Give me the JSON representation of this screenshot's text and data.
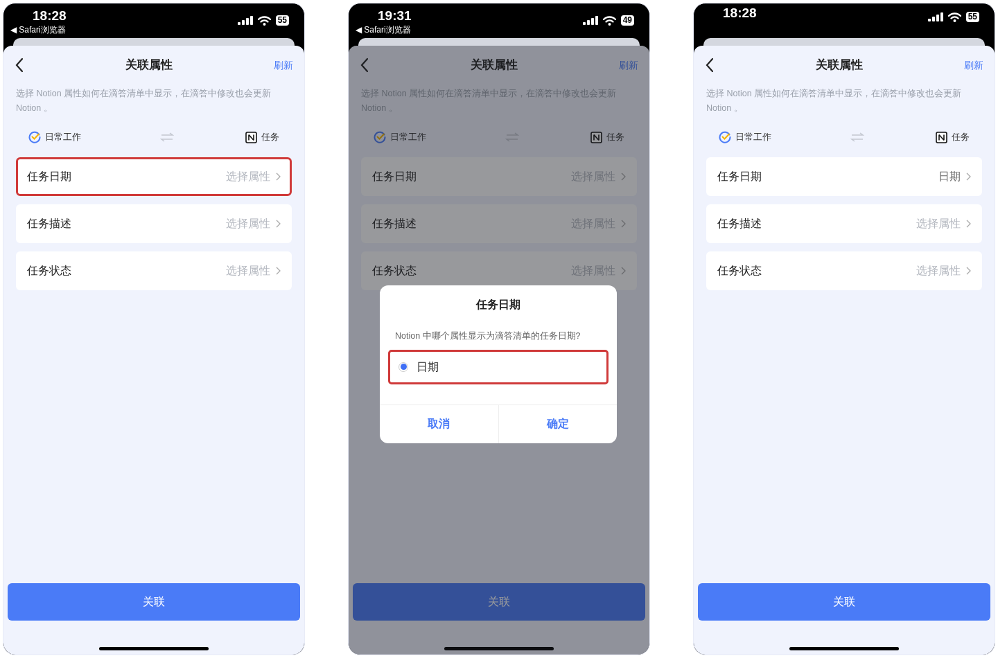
{
  "phones": [
    {
      "status_bar": {
        "time": "18:28",
        "back_app": "◀ Safari浏览器",
        "battery": "55"
      },
      "header": {
        "title": "关联属性",
        "action": "刷新"
      },
      "description": "选择 Notion 属性如何在滴答清单中显示，在滴答中修改也会更新 Notion 。",
      "source": "日常工作",
      "target": "任务",
      "rows": [
        {
          "label": "任务日期",
          "value": "选择属性",
          "set": false,
          "highlighted": true
        },
        {
          "label": "任务描述",
          "value": "选择属性",
          "set": false,
          "highlighted": false
        },
        {
          "label": "任务状态",
          "value": "选择属性",
          "set": false,
          "highlighted": false
        }
      ],
      "primary_button": "关联"
    },
    {
      "status_bar": {
        "time": "19:31",
        "back_app": "◀ Safari浏览器",
        "battery": "49"
      },
      "header": {
        "title": "关联属性",
        "action": "刷新"
      },
      "description": "选择 Notion 属性如何在滴答清单中显示，在滴答中修改也会更新 Notion 。",
      "source": "日常工作",
      "target": "任务",
      "rows": [
        {
          "label": "任务日期",
          "value": "选择属性",
          "set": false,
          "highlighted": false
        },
        {
          "label": "任务描述",
          "value": "选择属性",
          "set": false,
          "highlighted": false
        },
        {
          "label": "任务状态",
          "value": "选择属性",
          "set": false,
          "highlighted": false
        }
      ],
      "primary_button": "关联",
      "dialog": {
        "title": "任务日期",
        "question": "Notion 中哪个属性显示为滴答清单的任务日期?",
        "options": [
          {
            "label": "日期",
            "selected": true,
            "highlighted": true
          }
        ],
        "cancel": "取消",
        "confirm": "确定"
      }
    },
    {
      "status_bar": {
        "time": "18:28",
        "battery": "55"
      },
      "header": {
        "title": "关联属性",
        "action": "刷新"
      },
      "description": "选择 Notion 属性如何在滴答清单中显示，在滴答中修改也会更新 Notion 。",
      "source": "日常工作",
      "target": "任务",
      "rows": [
        {
          "label": "任务日期",
          "value": "日期",
          "set": true,
          "highlighted": false
        },
        {
          "label": "任务描述",
          "value": "选择属性",
          "set": false,
          "highlighted": false
        },
        {
          "label": "任务状态",
          "value": "选择属性",
          "set": false,
          "highlighted": false
        }
      ],
      "primary_button": "关联"
    }
  ]
}
